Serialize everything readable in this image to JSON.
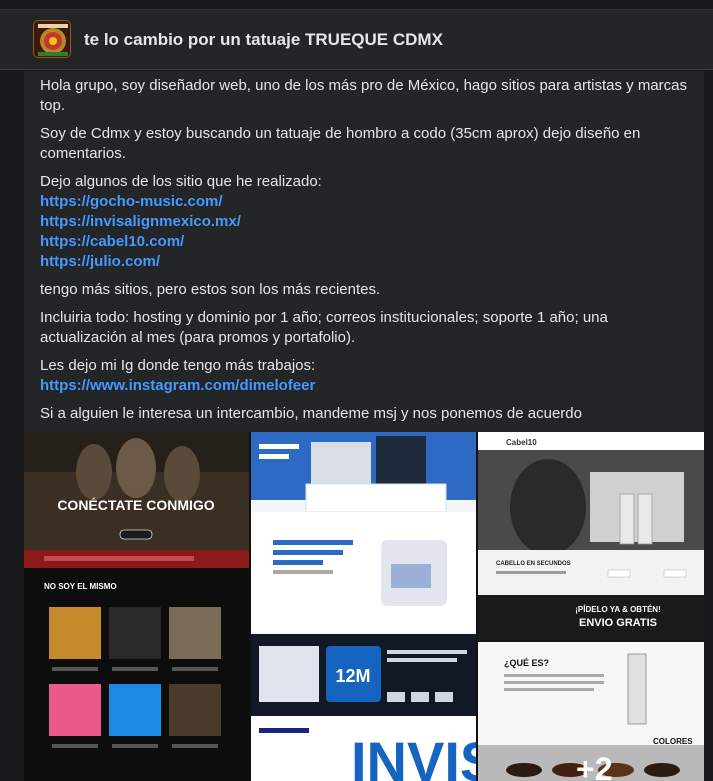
{
  "group": {
    "title": "te lo cambio por un tatuaje TRUEQUE CDMX"
  },
  "post": {
    "paragraphs": [
      "Hola grupo, soy diseñador web, uno de los más pro de México, hago sitios para artistas y marcas top.",
      "Soy de Cdmx y estoy buscando un tatuaje de hombro a codo (35cm aprox) dejo diseño en comentarios."
    ],
    "links_intro": "Dejo algunos de los sitio que he realizado:",
    "links": [
      "https://gocho-music.com/",
      "https://invisalignmexico.mx/",
      "https://cabel10.com/",
      "https://julio.com/"
    ],
    "more_sites": "tengo más sitios, pero estos son los más recientes.",
    "includes": "Incluiria todo: hosting y dominio por 1 año; correos institucionales; soporte 1 año; una actualización al mes (para promos y portafolio).",
    "ig_intro": "Les dejo mi Ig donde tengo más trabajos:",
    "ig_link": "https://www.instagram.com/dimelofeer",
    "closing": "Si a alguien le interesa un intercambio, mandeme msj y nos ponemos de acuerdo"
  },
  "media": {
    "tile1": {
      "hero_title": "CONÉCTATE CONMIGO",
      "section_title": "NO SOY EL MISMO"
    },
    "tile2": {
      "headline_big": "12M",
      "banner_text": "INVIS"
    },
    "tile3": {
      "brand": "Cabel10",
      "cabello_heading": "CABELLO EN SECUNDOS",
      "promo_line1": "¡PÍDELO YA & OBTÉN!",
      "promo_line2": "ENVIO GRATIS",
      "que_es": "¿QUÉ ES?",
      "colores": "COLORES"
    },
    "more_count": "+2"
  },
  "colors": {
    "background": "#18191a",
    "card": "#242526",
    "link": "#4599ff",
    "text": "#e4e6eb"
  }
}
